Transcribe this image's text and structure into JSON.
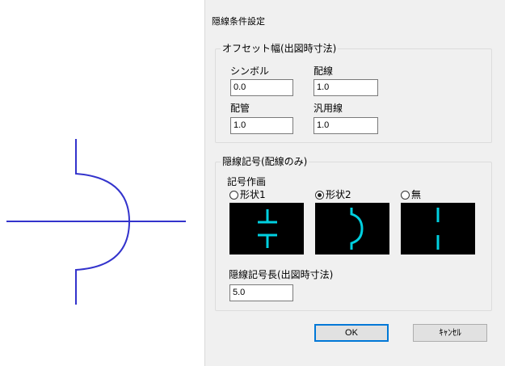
{
  "dialog": {
    "title": "隠線条件設定",
    "offset_group": {
      "legend": "オフセット幅(出図時寸法)",
      "symbol_label": "シンボル",
      "symbol_value": "0.0",
      "wiring_label": "配線",
      "wiring_value": "1.0",
      "piping_label": "配管",
      "piping_value": "1.0",
      "general_line_label": "汎用線",
      "general_line_value": "1.0"
    },
    "mark_group": {
      "legend": "隠線記号(配線のみ)",
      "drawing_label": "記号作画",
      "options": [
        {
          "label": "形状1",
          "selected": false
        },
        {
          "label": "形状2",
          "selected": true
        },
        {
          "label": "無",
          "selected": false
        }
      ],
      "length_label": "隠線記号長(出図時寸法)",
      "length_value": "5.0"
    },
    "buttons": {
      "ok": "OK",
      "cancel": "ｷｬﾝｾﾙ"
    }
  },
  "colors": {
    "preview_line": "#3333cc",
    "symbol_line": "#00d0e0",
    "symbol_bg": "#000000",
    "default_border": "#0078d7"
  },
  "icons": {
    "shape1": "gap-line-symbol-icon",
    "shape2": "arc-bridge-symbol-icon",
    "none": "plain-gap-symbol-icon"
  }
}
